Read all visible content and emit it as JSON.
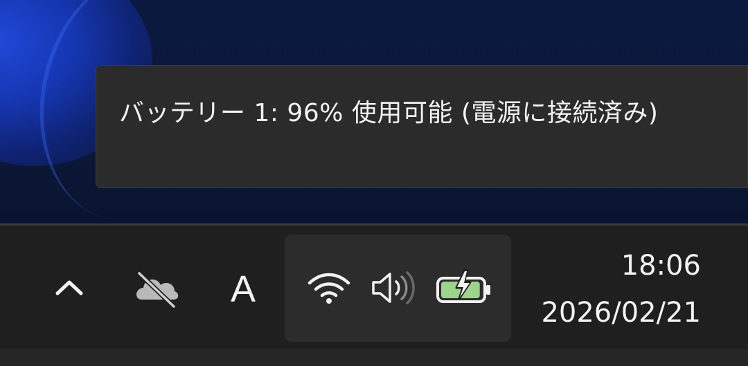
{
  "tooltip": {
    "text": "バッテリー 1: 96% 使用可能 (電源に接続済み)"
  },
  "tray": {
    "ime_label": "A",
    "icons": {
      "overflow": "chevron-up-icon",
      "onedrive": "onedrive-paused-icon",
      "wifi": "wifi-icon",
      "volume": "volume-icon",
      "battery": "battery-charging-icon"
    },
    "battery_level": 0.96
  },
  "clock": {
    "time": "18:06",
    "date": "2026/02/21"
  },
  "colors": {
    "battery_fill": "#9bd48a",
    "icon": "#f2f2f2",
    "tooltip_bg": "#2b2b2b",
    "taskbar_bg": "#1f1f1f"
  }
}
